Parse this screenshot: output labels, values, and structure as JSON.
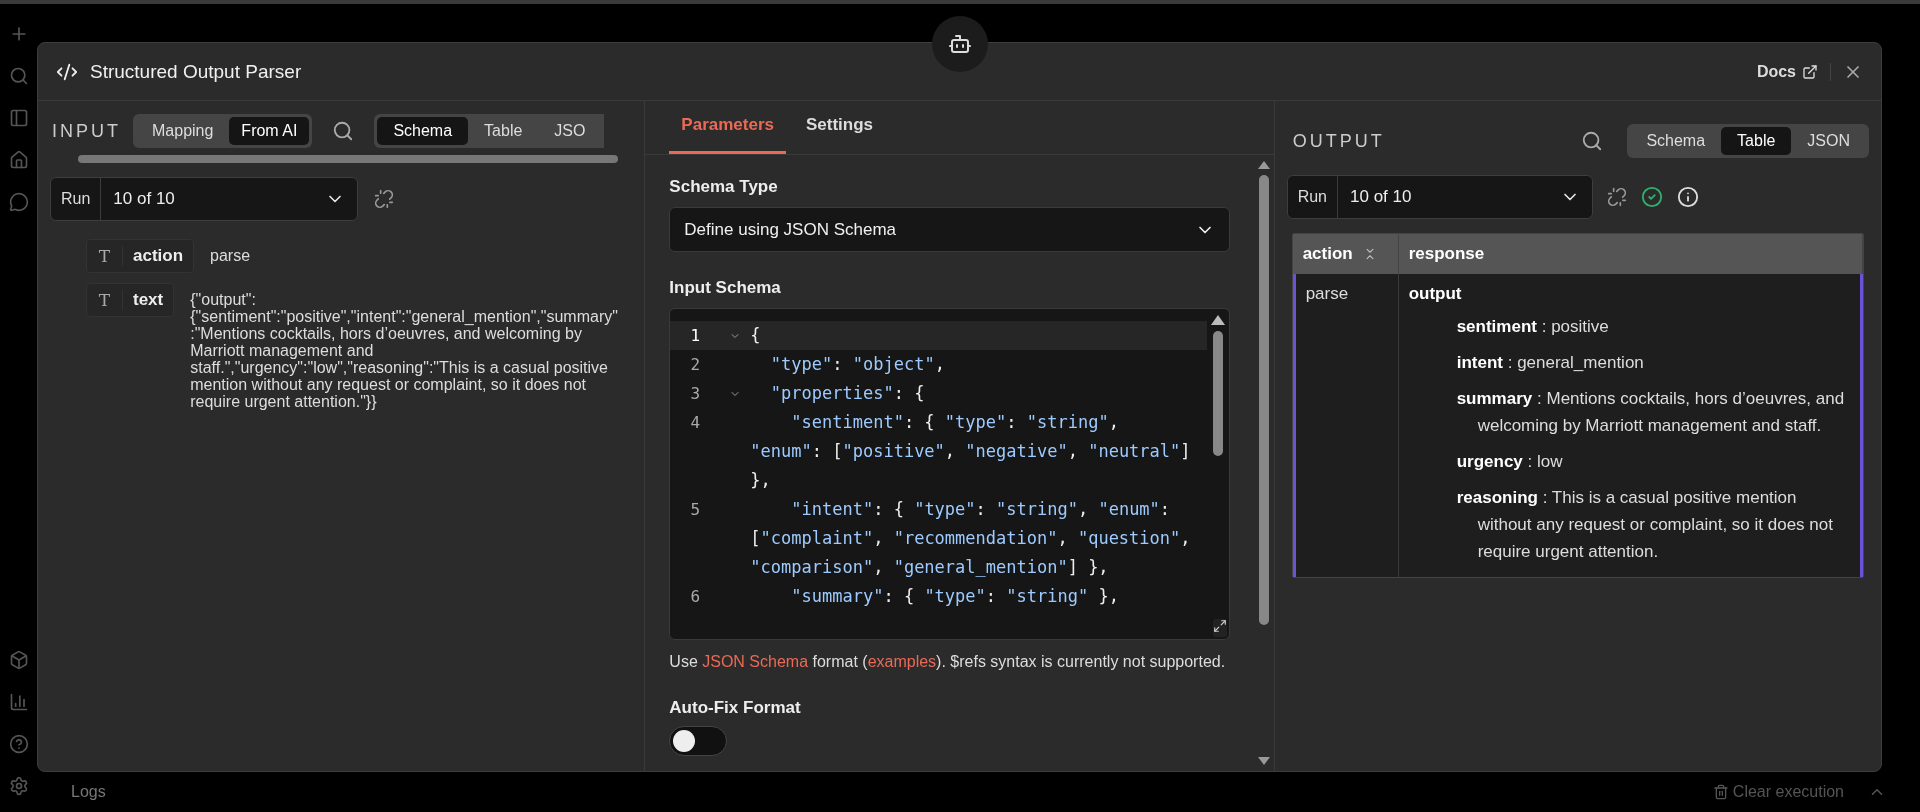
{
  "modal": {
    "title": "Structured Output Parser",
    "docs_label": "Docs"
  },
  "input_panel": {
    "heading": "INPUT",
    "modes": [
      {
        "label": "Mapping",
        "selected": false
      },
      {
        "label": "From AI",
        "selected": true
      }
    ],
    "views": [
      {
        "label": "Schema",
        "selected": true
      },
      {
        "label": "Table",
        "selected": false
      },
      {
        "label": "JSO",
        "selected": false
      }
    ],
    "run_label": "Run",
    "run_value": "10 of 10",
    "fields": [
      {
        "type_glyph": "T",
        "name": "action",
        "value": "parse"
      },
      {
        "type_glyph": "T",
        "name": "text",
        "value": "{\"output\":{\"sentiment\":\"positive\",\"intent\":\"general_mention\",\"summary\":\"Mentions cocktails, hors d’oeuvres, and welcoming by Marriott management and staff.\",\"urgency\":\"low\",\"reasoning\":\"This is a casual positive mention without any request or complaint, so it does not require urgent attention.\"}}"
      }
    ]
  },
  "parameters_panel": {
    "tabs": [
      {
        "label": "Parameters",
        "selected": true
      },
      {
        "label": "Settings",
        "selected": false
      }
    ],
    "schema_type_label": "Schema Type",
    "schema_type_value": "Define using JSON Schema",
    "input_schema_label": "Input Schema",
    "code_lines": [
      {
        "number": "1",
        "foldable": true,
        "active": true,
        "text": "{"
      },
      {
        "number": "2",
        "foldable": false,
        "active": false,
        "text": "  \"type\": \"object\","
      },
      {
        "number": "3",
        "foldable": true,
        "active": false,
        "text": "  \"properties\": {"
      },
      {
        "number": "4",
        "foldable": false,
        "active": false,
        "text": "    \"sentiment\": { \"type\": \"string\", \"enum\": [\"positive\", \"negative\", \"neutral\"] },"
      },
      {
        "number": "5",
        "foldable": false,
        "active": false,
        "text": "    \"intent\": { \"type\": \"string\", \"enum\": [\"complaint\", \"recommendation\", \"question\", \"comparison\", \"general_mention\"] },"
      },
      {
        "number": "6",
        "foldable": false,
        "active": false,
        "text": "    \"summary\": { \"type\": \"string\" },"
      }
    ],
    "help": [
      {
        "kind": "text",
        "text": "Use "
      },
      {
        "kind": "link",
        "text": "JSON Schema"
      },
      {
        "kind": "text",
        "text": " format ("
      },
      {
        "kind": "link",
        "text": "examples"
      },
      {
        "kind": "text",
        "text": "). $refs syntax is currently not supported."
      }
    ],
    "auto_fix_label": "Auto-Fix Format",
    "auto_fix_on": false
  },
  "output_panel": {
    "heading": "OUTPUT",
    "views": [
      {
        "label": "Schema",
        "selected": false
      },
      {
        "label": "Table",
        "selected": true
      },
      {
        "label": "JSON",
        "selected": false
      }
    ],
    "run_label": "Run",
    "run_value": "10 of 10",
    "columns": [
      {
        "label": "action",
        "kind": "sortable"
      },
      {
        "label": "response",
        "kind": "plain"
      }
    ],
    "rows": [
      {
        "selected": true,
        "action": "parse",
        "response_key": "output",
        "fields": [
          {
            "key": "sentiment",
            "separator": ":",
            "value": "positive"
          },
          {
            "key": "intent",
            "separator": ":",
            "value": "general_mention"
          },
          {
            "key": "summary",
            "separator": ":",
            "value": "Mentions cocktails, hors d’oeuvres, and welcoming by Marriott management and staff."
          },
          {
            "key": "urgency",
            "separator": ":",
            "value": "low"
          },
          {
            "key": "reasoning",
            "separator": ":",
            "value": "This is a casual positive mention without any request or complaint, so it does not require urgent attention."
          }
        ]
      }
    ]
  },
  "logs_bar": {
    "label": "Logs",
    "clear_label": "Clear execution"
  }
}
